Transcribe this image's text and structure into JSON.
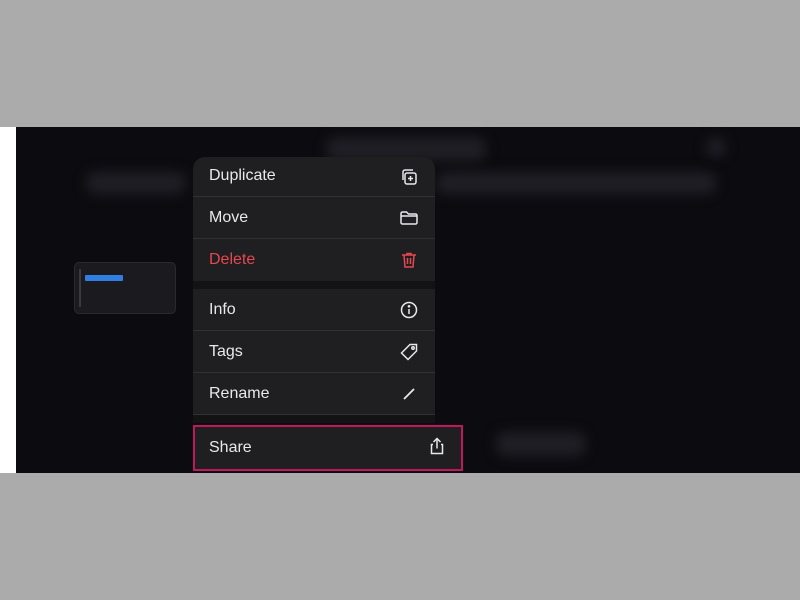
{
  "menu": {
    "items": [
      {
        "label": "Duplicate",
        "icon": "duplicate-icon"
      },
      {
        "label": "Move",
        "icon": "folder-icon"
      },
      {
        "label": "Delete",
        "icon": "trash-icon"
      },
      {
        "label": "Info",
        "icon": "info-icon"
      },
      {
        "label": "Tags",
        "icon": "tag-icon"
      },
      {
        "label": "Rename",
        "icon": "pencil-icon"
      },
      {
        "label": "Share",
        "icon": "share-icon"
      }
    ]
  },
  "colors": {
    "page_background": "#ababab",
    "app_background": "#0b0b10",
    "menu_background": "#1f1f22",
    "menu_text": "#e9e9ec",
    "danger": "#e5484d",
    "highlight_border": "#c2185b",
    "thumbnail_accent": "#2f7fe3"
  }
}
